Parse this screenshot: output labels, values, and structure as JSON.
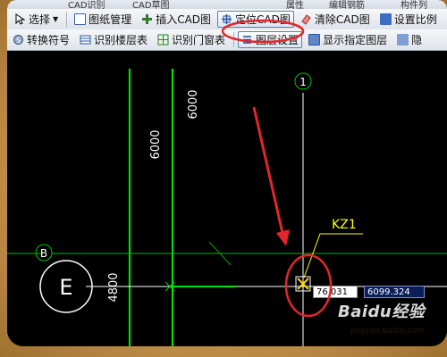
{
  "toolbar_top": {
    "items": [
      "CAD识别",
      "CAD草图",
      "属性",
      "编辑钢筋",
      "构件列"
    ]
  },
  "toolbar1": {
    "select_label": "选择",
    "drawing_mgmt_label": "图纸管理",
    "insert_cad_label": "插入CAD图",
    "locate_cad_label": "定位CAD图",
    "clear_cad_label": "清除CAD图",
    "set_scale_label": "设置比例"
  },
  "toolbar2": {
    "convert_symbol_label": "转换符号",
    "identify_floor_table_label": "识别楼层表",
    "identify_door_window_label": "识别门窗表",
    "layer_settings_label": "图层设置",
    "show_layer_label": "显示指定图层",
    "hide_label": "隐"
  },
  "canvas": {
    "dim_6000_a": "6000",
    "dim_6000_b": "6000",
    "dim_4800": "4800",
    "axis_1": "1",
    "axis_b": "B",
    "axis_e": "E",
    "column_label": "KZ1",
    "coord_x": "76.031",
    "coord_y": "6099.324"
  },
  "watermark": {
    "text": "Baidu经验",
    "sub": "jingyan.baidu.com"
  },
  "colors": {
    "canvas_bg": "#000000",
    "axis_green": "#00e000",
    "grid_line": "#ffffff",
    "label_yellow": "#ffff00",
    "annotation_red": "#e3252c",
    "coord_highlight": "#0a1f5a"
  }
}
